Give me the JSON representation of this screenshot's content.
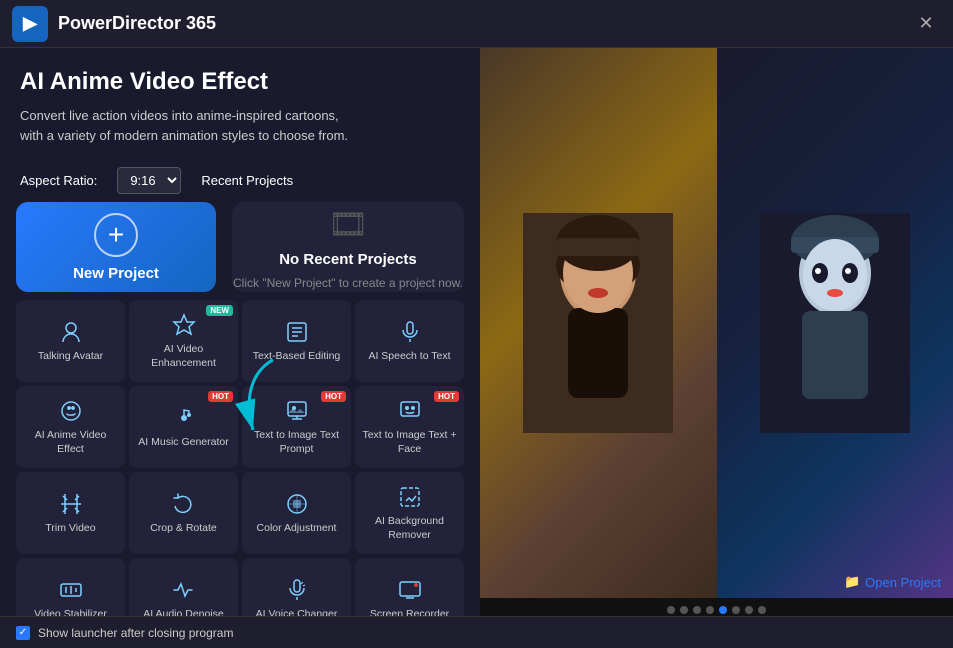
{
  "app": {
    "title": "PowerDirector 365",
    "logo_char": "▶"
  },
  "hero": {
    "title": "AI Anime Video Effect",
    "description": "Convert live action videos into anime-inspired cartoons, with a variety of modern animation styles to choose from."
  },
  "controls": {
    "aspect_label": "Aspect Ratio:",
    "aspect_value": "9:16",
    "recent_label": "Recent Projects"
  },
  "new_project": {
    "label": "New Project"
  },
  "recent_projects": {
    "empty_title": "No Recent Projects",
    "empty_desc": "Click \"New Project\" to create a project now."
  },
  "open_project": {
    "label": "Open Project"
  },
  "tools": [
    {
      "id": "talking-avatar",
      "label": "Talking Avatar",
      "icon": "👤",
      "badge": null
    },
    {
      "id": "ai-video-enhancement",
      "label": "AI Video Enhancement",
      "icon": "✨",
      "badge": "NEW"
    },
    {
      "id": "text-based-editing",
      "label": "Text-Based Editing",
      "icon": "✏️",
      "badge": null
    },
    {
      "id": "ai-speech-to-text",
      "label": "AI Speech to Text",
      "icon": "🎤",
      "badge": null
    },
    {
      "id": "ai-anime-video-effect",
      "label": "AI Anime Video Effect",
      "icon": "🌀",
      "badge": null
    },
    {
      "id": "ai-music-generator",
      "label": "AI Music Generator",
      "icon": "🎵",
      "badge": "HOT"
    },
    {
      "id": "text-to-image-prompt",
      "label": "Text to Image Text Prompt",
      "icon": "🖼️",
      "badge": "HOT"
    },
    {
      "id": "text-to-image-face",
      "label": "Text to Image Text + Face",
      "icon": "🎨",
      "badge": "HOT"
    },
    {
      "id": "trim-video",
      "label": "Trim Video",
      "icon": "✂️",
      "badge": null
    },
    {
      "id": "crop-rotate",
      "label": "Crop & Rotate",
      "icon": "🔄",
      "badge": null
    },
    {
      "id": "color-adjustment",
      "label": "Color Adjustment",
      "icon": "🎨",
      "badge": null
    },
    {
      "id": "ai-background-remover",
      "label": "AI Background Remover",
      "icon": "🖼",
      "badge": null
    },
    {
      "id": "video-stabilizer",
      "label": "Video Stabilizer",
      "icon": "📽",
      "badge": null
    },
    {
      "id": "ai-audio-denoise",
      "label": "AI Audio Denoise",
      "icon": "〰",
      "badge": null
    },
    {
      "id": "ai-voice-changer",
      "label": "AI Voice Changer",
      "icon": "🎙",
      "badge": null
    },
    {
      "id": "screen-recorder",
      "label": "Screen Recorder",
      "icon": "🖥",
      "badge": null
    }
  ],
  "image_dots": [
    0,
    1,
    2,
    3,
    4,
    5,
    6,
    7
  ],
  "active_dot": 4,
  "bottom": {
    "checkbox_label": "Show launcher after closing program"
  }
}
